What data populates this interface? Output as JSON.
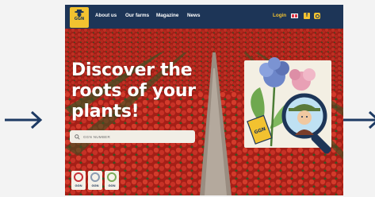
{
  "nav": {
    "logo_text": "GGN",
    "links": [
      "About us",
      "Our farms",
      "Magazine",
      "News"
    ],
    "login_label": "Login",
    "facebook_glyph": "f"
  },
  "hero": {
    "title": "Discover the roots of your plants!",
    "search_placeholder": "GGN NUMBER"
  },
  "badges": [
    {
      "label": "GGN"
    },
    {
      "label": "GGN"
    },
    {
      "label": "GGN"
    }
  ],
  "illustration": {
    "tag_text": "GGN"
  },
  "icons": [
    "arrow-right-icon",
    "search-icon",
    "flag-icon",
    "facebook-icon",
    "instagram-icon",
    "magnifier-icon"
  ],
  "colors": {
    "nav": "#1d3557",
    "accent": "#f2c230",
    "tulip_red": "#c8281f",
    "arrow": "#1d3a63"
  }
}
